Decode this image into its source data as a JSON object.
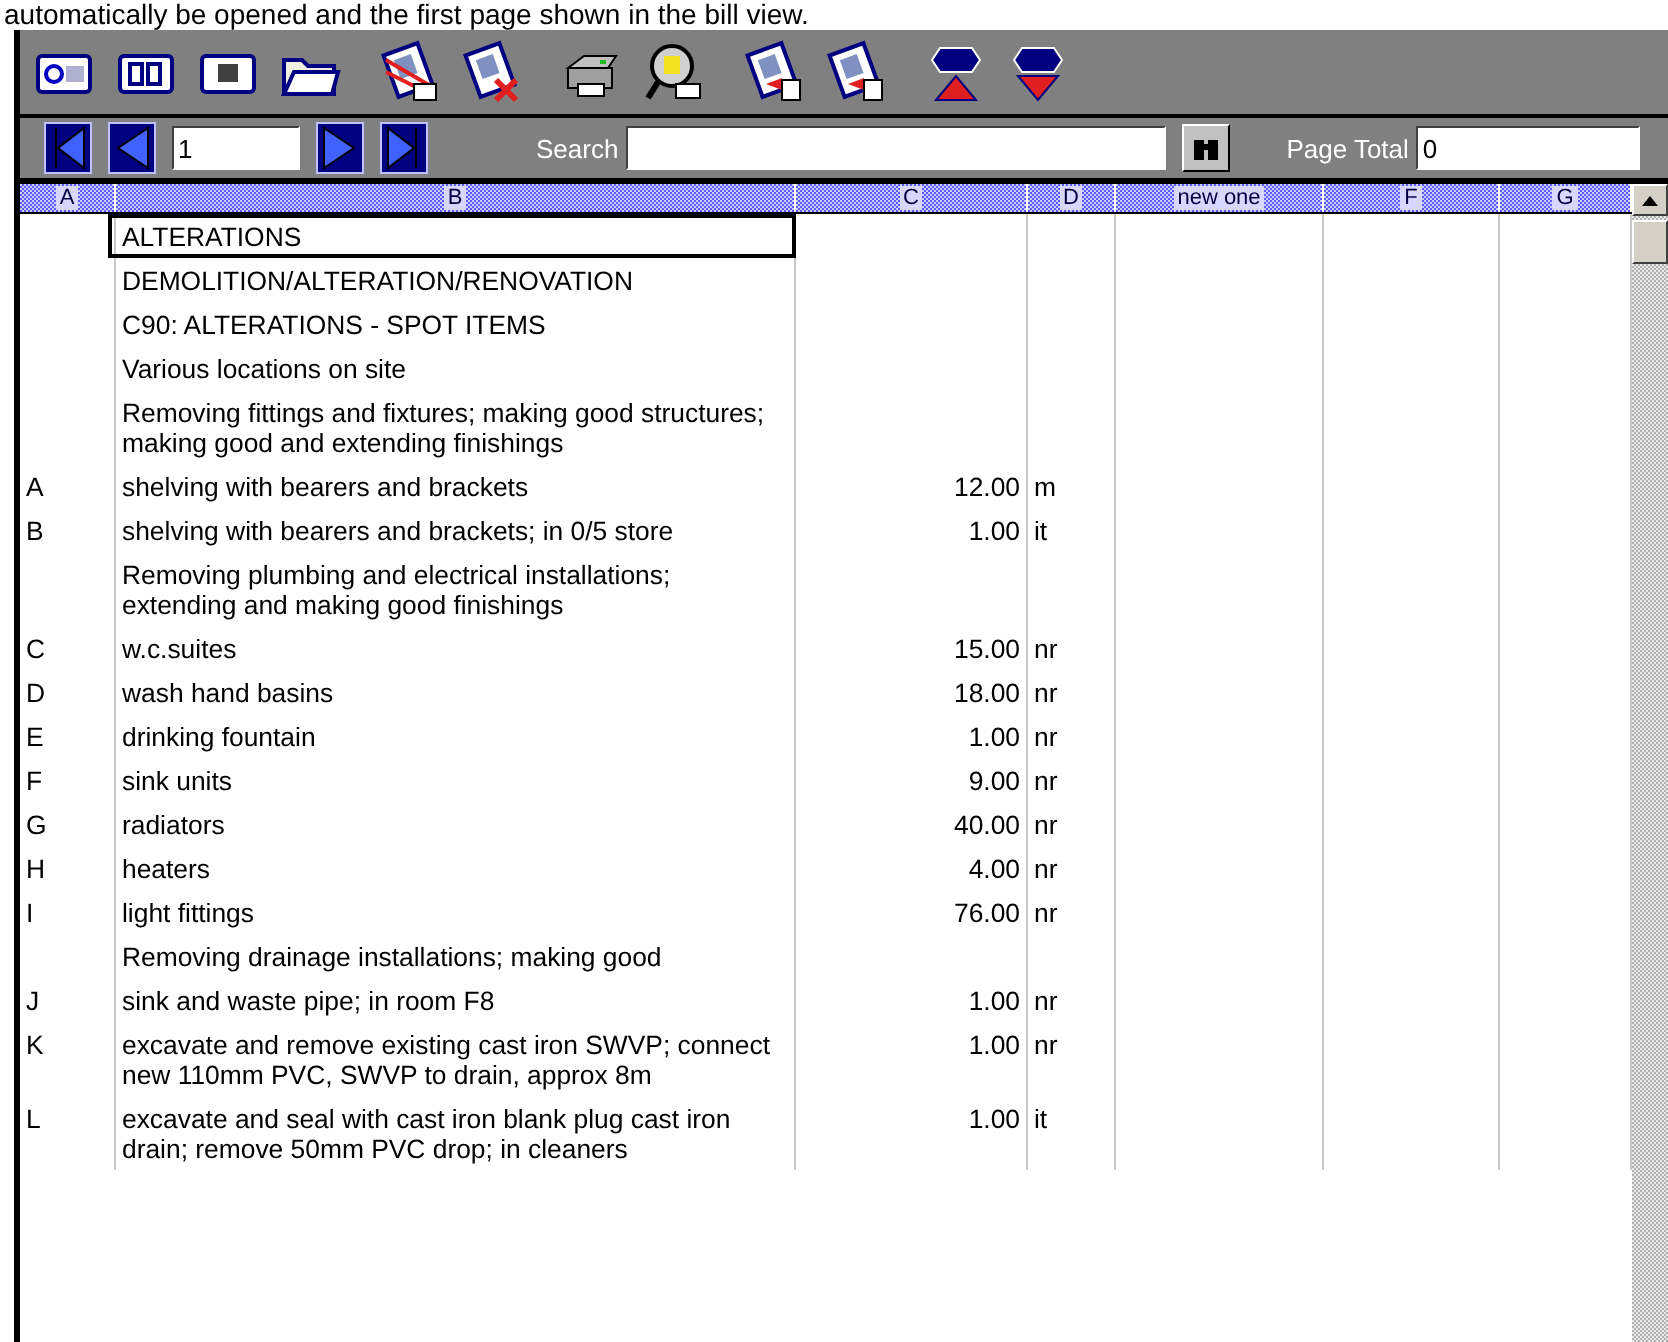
{
  "caption": "automatically be opened and the first page shown in the bill view.",
  "navigation": {
    "page": "1",
    "search_label": "Search",
    "page_total_label": "Page Total",
    "page_total": "0"
  },
  "grid": {
    "columns": [
      "A",
      "B",
      "C",
      "D",
      "new one",
      "F",
      "G"
    ],
    "rows": [
      {
        "description": "ALTERATIONS",
        "selected": true
      },
      {
        "description": "DEMOLITION/ALTERATION/RENOVATION",
        "selected": false
      },
      {
        "description": "C90: ALTERATIONS - SPOT ITEMS",
        "selected": false
      },
      {
        "description": "Various locations on site",
        "selected": false
      },
      {
        "description": "Removing fittings and fixtures; making good structures; making good and extending finishings",
        "selected": false
      },
      {
        "item": "A",
        "description": "shelving with bearers and brackets",
        "quantity": "12.00",
        "unit": "m",
        "selected": false
      },
      {
        "item": "B",
        "description": "shelving with bearers and brackets; in 0/5 store",
        "quantity": "1.00",
        "unit": "it",
        "selected": false
      },
      {
        "description": "Removing plumbing and electrical installations; extending and making good finishings",
        "selected": false
      },
      {
        "item": "C",
        "description": "w.c.suites",
        "quantity": "15.00",
        "unit": "nr",
        "selected": false
      },
      {
        "item": "D",
        "description": "wash hand basins",
        "quantity": "18.00",
        "unit": "nr",
        "selected": false
      },
      {
        "item": "E",
        "description": "drinking fountain",
        "quantity": "1.00",
        "unit": "nr",
        "selected": false
      },
      {
        "item": "F",
        "description": "sink units",
        "quantity": "9.00",
        "unit": "nr",
        "selected": false
      },
      {
        "item": "G",
        "description": "radiators",
        "quantity": "40.00",
        "unit": "nr",
        "selected": false
      },
      {
        "item": "H",
        "description": "heaters",
        "quantity": "4.00",
        "unit": "nr",
        "selected": false
      },
      {
        "item": "I",
        "description": "light fittings",
        "quantity": "76.00",
        "unit": "nr",
        "selected": false
      },
      {
        "description": "Removing drainage installations; making good",
        "selected": false
      },
      {
        "item": "J",
        "description": "sink and waste pipe; in room F8",
        "quantity": "1.00",
        "unit": "nr",
        "selected": false
      },
      {
        "item": "K",
        "description": "excavate and remove existing cast iron SWVP; connect new 110mm PVC, SWVP to drain, approx 8m",
        "quantity": "1.00",
        "unit": "nr",
        "selected": false
      },
      {
        "item": "L",
        "description": "excavate and seal with cast iron blank plug cast iron drain; remove 50mm PVC drop; in cleaners",
        "quantity": "1.00",
        "unit": "it",
        "selected": false
      }
    ]
  }
}
